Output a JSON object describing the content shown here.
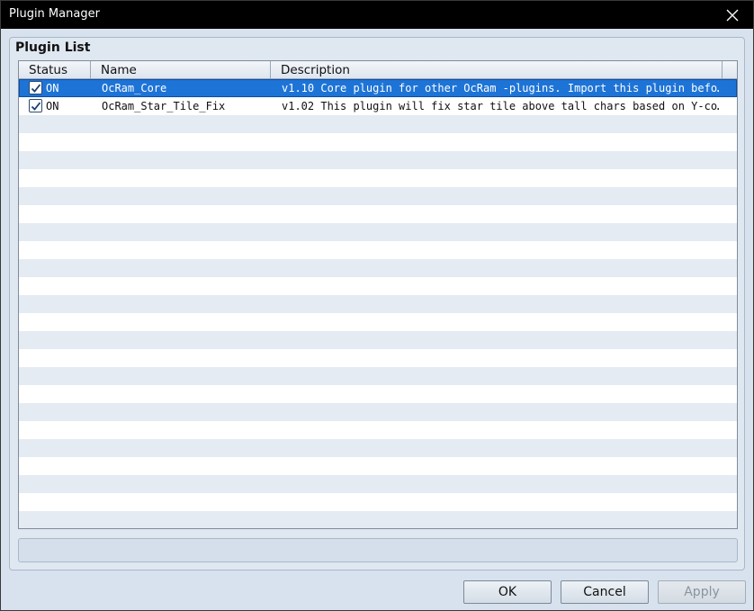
{
  "window": {
    "title": "Plugin Manager"
  },
  "group": {
    "title": "Plugin List"
  },
  "columns": {
    "status": "Status",
    "name": "Name",
    "description": "Description"
  },
  "plugins": [
    {
      "checked": true,
      "status": "ON",
      "name": "OcRam_Core",
      "description": "v1.10 Core plugin for other OcRam -plugins. Import this plugin befo…",
      "selected": true
    },
    {
      "checked": true,
      "status": "ON",
      "name": "OcRam_Star_Tile_Fix",
      "description": "v1.02 This plugin will fix star tile above tall chars based on Y-co…",
      "selected": false
    }
  ],
  "buttons": {
    "ok": "OK",
    "cancel": "Cancel",
    "apply": "Apply"
  },
  "colors": {
    "selection": "#1e74d6",
    "alt_row": "#e4ebf2",
    "title_bar": "#000000"
  }
}
